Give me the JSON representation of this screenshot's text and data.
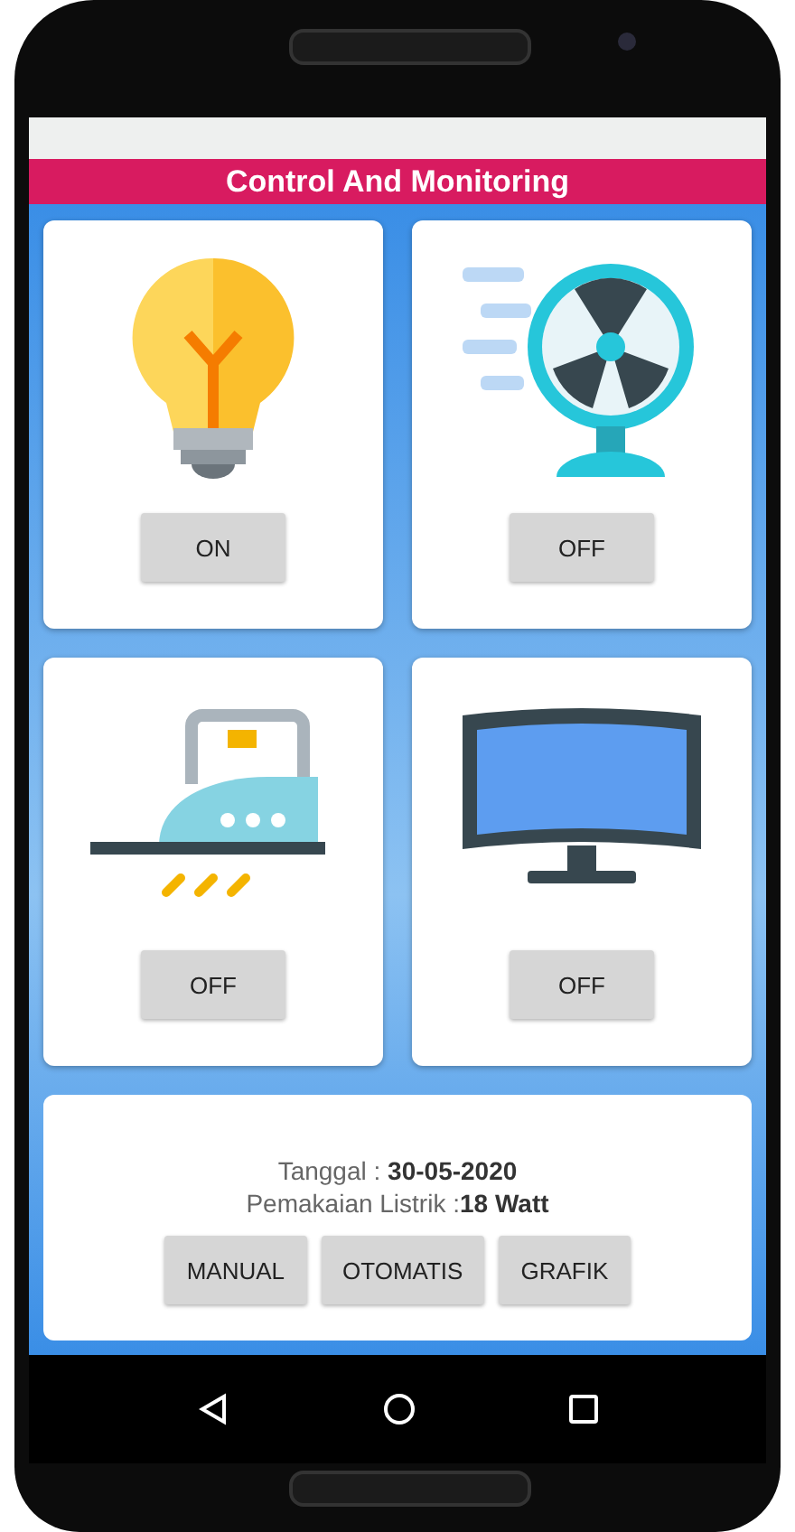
{
  "app_bar": {
    "title": "Control And Monitoring"
  },
  "devices": [
    {
      "kind": "lamp",
      "button": "ON"
    },
    {
      "kind": "fan",
      "button": "OFF"
    },
    {
      "kind": "iron",
      "button": "OFF"
    },
    {
      "kind": "monitor",
      "button": "OFF"
    }
  ],
  "info": {
    "date": "Tanggal : **30-05-2020**",
    "usage": "Pemakaian Listrik :**18 Watt**"
  },
  "buttons": [
    "MANUAL",
    "OTOMATIS",
    "GRAFIK"
  ]
}
